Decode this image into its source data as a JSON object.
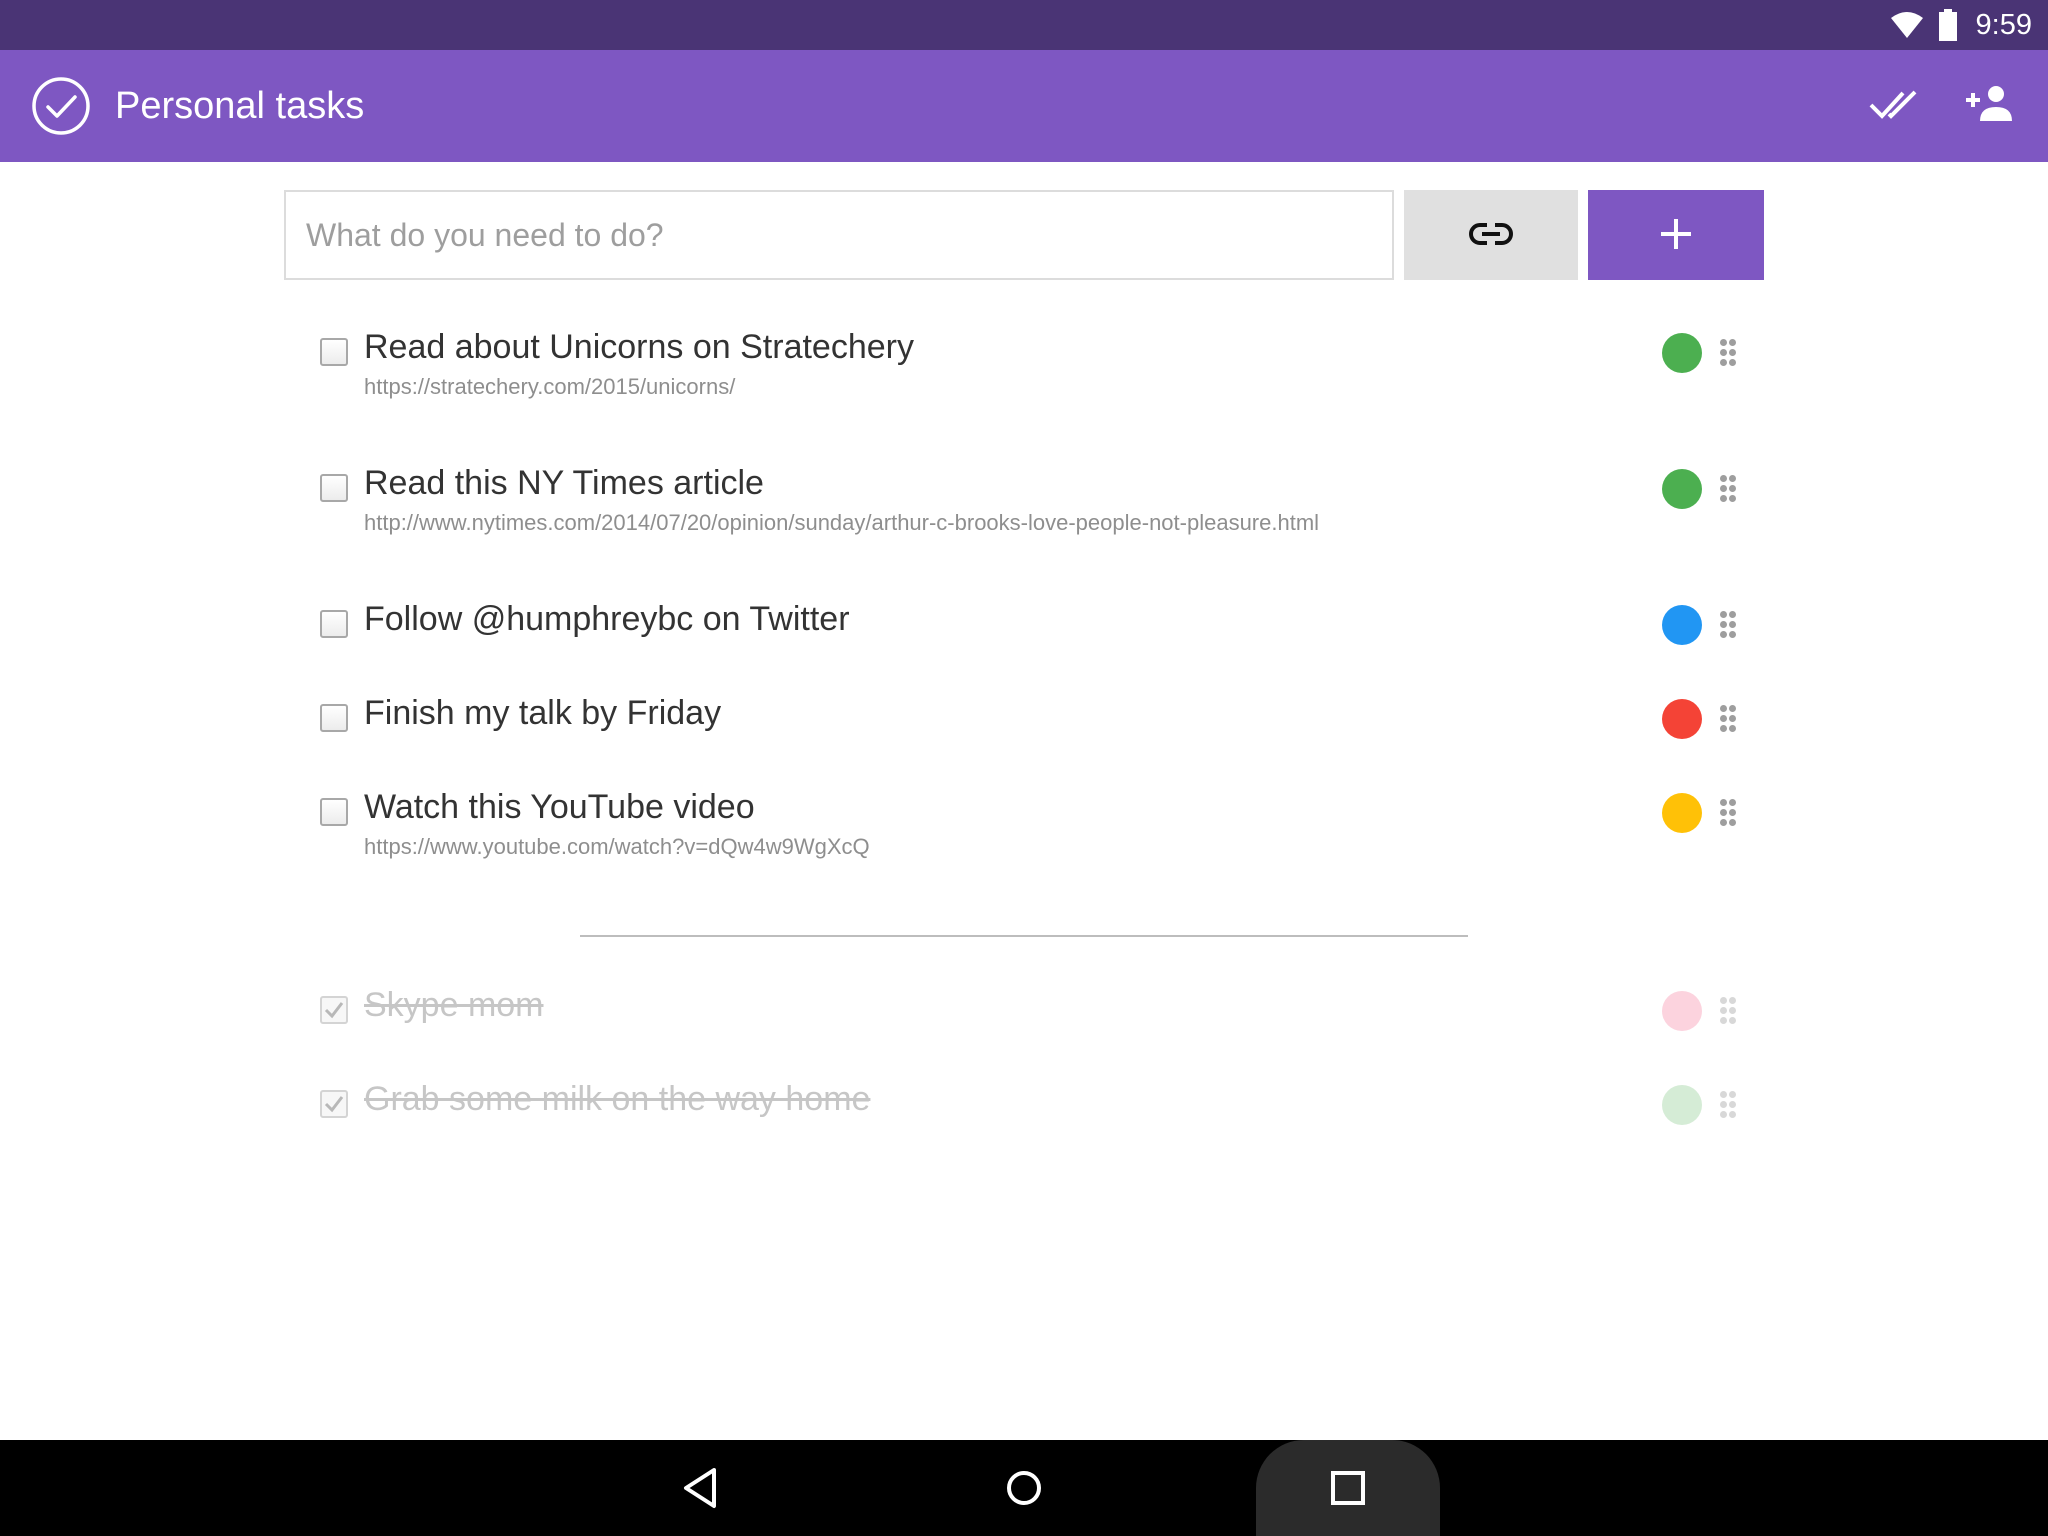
{
  "status_bar": {
    "time": "9:59",
    "icons": [
      "wifi-icon",
      "battery-icon"
    ]
  },
  "app_bar": {
    "title": "Personal tasks",
    "logo_icon": "check-circle-icon",
    "actions": [
      "mark-all-done-icon",
      "add-person-icon"
    ],
    "color": "#7e57c2"
  },
  "input": {
    "placeholder": "What do you need to do?",
    "value": "",
    "link_icon": "link-icon",
    "add_icon": "plus-icon"
  },
  "tasks": [
    {
      "title": "Read about Unicorns on Stratechery",
      "url": "https://stratechery.com/2015/unicorns/",
      "color": "#4caf50",
      "done": false
    },
    {
      "title": "Read this NY Times article",
      "url": "http://www.nytimes.com/2014/07/20/opinion/sunday/arthur-c-brooks-love-people-not-pleasure.html",
      "color": "#4caf50",
      "done": false
    },
    {
      "title": "Follow @humphreybc on Twitter",
      "url": "",
      "color": "#2196f3",
      "done": false
    },
    {
      "title": "Finish my talk by Friday",
      "url": "",
      "color": "#f44336",
      "done": false
    },
    {
      "title": "Watch this YouTube video",
      "url": "https://www.youtube.com/watch?v=dQw4w9WgXcQ",
      "color": "#ffc107",
      "done": false
    }
  ],
  "completed": [
    {
      "title": "Skype mom",
      "color": "#fcd3de",
      "done": true
    },
    {
      "title": "Grab some milk on the way home",
      "color": "#d5ecd6",
      "done": true
    }
  ],
  "nav_bar": {
    "icons": [
      "back-icon",
      "home-icon",
      "recents-icon"
    ]
  }
}
